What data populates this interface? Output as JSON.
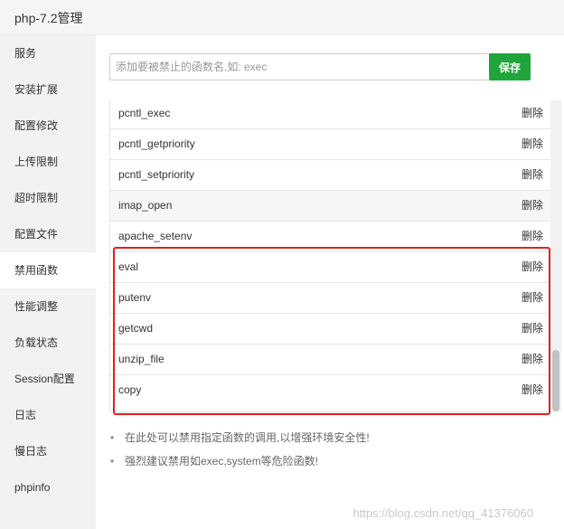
{
  "window": {
    "title": "php-7.2管理"
  },
  "sidebar": {
    "items": [
      {
        "label": "服务"
      },
      {
        "label": "安装扩展"
      },
      {
        "label": "配置修改"
      },
      {
        "label": "上传限制"
      },
      {
        "label": "超时限制"
      },
      {
        "label": "配置文件"
      },
      {
        "label": "禁用函数",
        "active": true
      },
      {
        "label": "性能调整"
      },
      {
        "label": "负载状态"
      },
      {
        "label": "Session配置"
      },
      {
        "label": "日志"
      },
      {
        "label": "慢日志"
      },
      {
        "label": "phpinfo"
      }
    ]
  },
  "form": {
    "placeholder": "添加要被禁止的函数名,如: exec",
    "save_label": "保存"
  },
  "functions": {
    "delete_label": "删除",
    "items": [
      {
        "name": "pcntl_exec"
      },
      {
        "name": "pcntl_getpriority"
      },
      {
        "name": "pcntl_setpriority"
      },
      {
        "name": "imap_open"
      },
      {
        "name": "apache_setenv"
      },
      {
        "name": "eval"
      },
      {
        "name": "putenv"
      },
      {
        "name": "getcwd"
      },
      {
        "name": "unzip_file"
      },
      {
        "name": "copy"
      }
    ]
  },
  "tips": [
    "在此处可以禁用指定函数的调用,以增强环境安全性!",
    "强烈建议禁用如exec,system等危险函数!"
  ],
  "watermark": "https://blog.csdn.net/qq_41376060",
  "colors": {
    "accent": "#20a53a",
    "highlight": "#e02020"
  }
}
